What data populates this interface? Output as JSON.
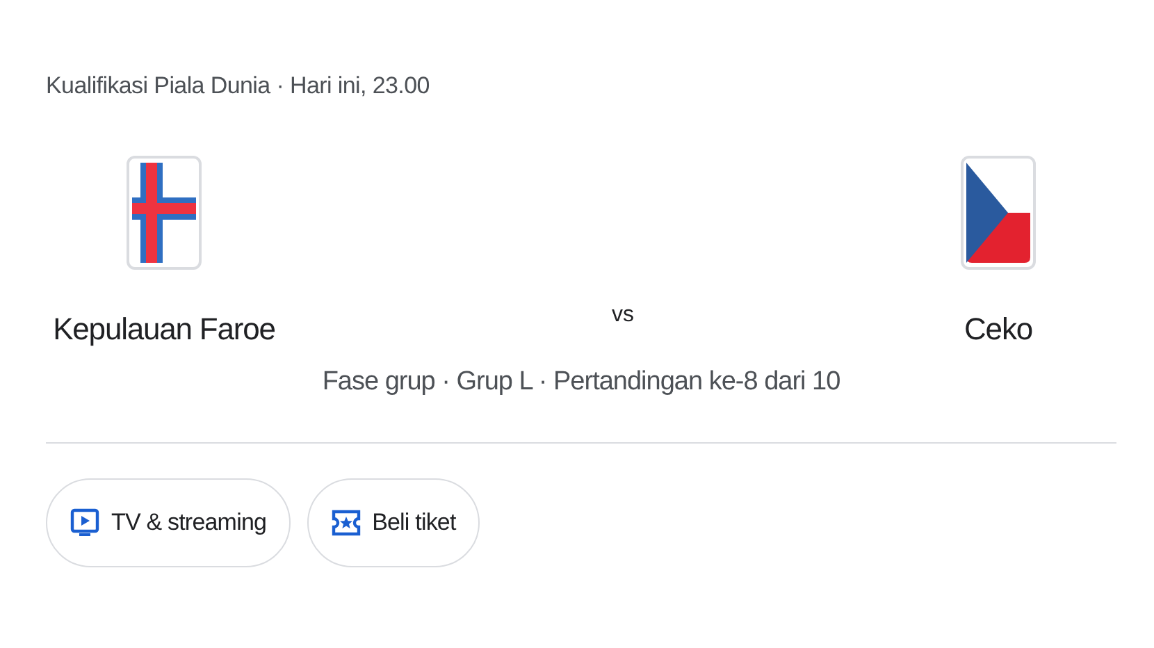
{
  "header": "Kualifikasi Piala Dunia · Hari ini, 23.00",
  "teams": [
    {
      "name": "Kepulauan Faroe",
      "kind": "faroe"
    },
    {
      "name": "Ceko",
      "kind": "czech"
    }
  ],
  "vs": "vs",
  "details": "Fase grup · Grup L · Pertandingan ke-8 dari 10",
  "buttons": [
    {
      "label": "TV & streaming",
      "kind": "tv"
    },
    {
      "label": "Beli tiket",
      "kind": "ticket"
    }
  ]
}
